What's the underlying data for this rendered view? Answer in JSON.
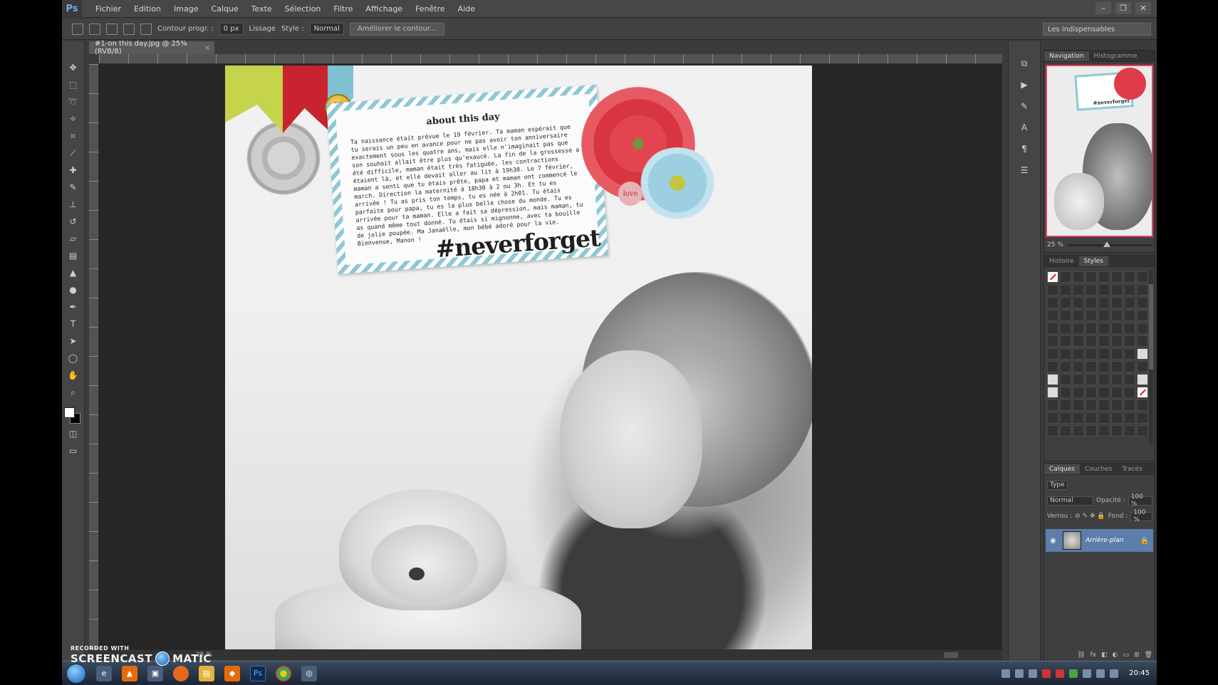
{
  "app": {
    "logo": "Ps",
    "menu": [
      "Fichier",
      "Edition",
      "Image",
      "Calque",
      "Texte",
      "Sélection",
      "Filtre",
      "Affichage",
      "Fenêtre",
      "Aide"
    ],
    "window_controls": [
      "–",
      "❐",
      "✕"
    ]
  },
  "options": {
    "contour_label": "Contour progr. :",
    "contour_value": "0 px",
    "lissage_label": "Lissage",
    "style_label": "Style :",
    "style_value": "Normal",
    "refine_button": "Améliorer le contour...",
    "workspace": "Les indispensables"
  },
  "document": {
    "tab_title": "#1-on this day.jpg @ 25% (RVB/8)",
    "close": "×",
    "zoom_status": "25 %"
  },
  "artwork": {
    "card_title": "about this day",
    "card_text": "Ta naissance était prévue le 19 février. Ta maman espérait que tu serais un peu en avance pour ne pas avoir ton anniversaire exactement sous les quatre ans, mais elle n'imaginait pas que son souhait allait être plus qu'exaucé. La fin de la grossesse a été difficile, maman était très fatiguée, les contractions étaient là, et elle devait aller au lit à 19h30. Le 7 février, maman a senti que tu étais prête, papa et maman ont commencé le march. Direction la maternité à 18h30 à 2 ou 3h. Et tu es arrivée ! Tu as pris ton temps, tu es née à 2h01. Tu étais parfaite pour papa, tu es la plus belle chose du monde. Tu es arrivée pour ta maman. Elle a fait sa dépression, mais maman, tu as quand même tout donné. Tu étais si mignonne, avec ta bouille de jolie poupée. Ma Janaëlle, mon bébé adoré pour la vie. Bienvenue, Manon !",
    "hashtag": "#neverforget",
    "love_label": "love",
    "heart": "♥"
  },
  "panels": {
    "navigator_tabs": [
      "Navigation",
      "Histogramme"
    ],
    "navigator_hashtag": "#neverforget",
    "navigator_zoom": "25 %",
    "styles_tabs": [
      "Histoire",
      "Styles"
    ],
    "layers_tabs": [
      "Calques",
      "Couches",
      "Tracés"
    ],
    "layers_kind": "Type",
    "blend_mode": "Normal",
    "opacity_label": "Opacité :",
    "opacity_value": "100 %",
    "lock_label": "Verrou :",
    "fill_label": "Fond :",
    "fill_value": "100 %",
    "layer_name": "Arrière-plan"
  },
  "taskbar": {
    "clock": "20:45",
    "watermark_line1": "RECORDED WITH",
    "watermark_brand": "SCREENCAST",
    "watermark_brand2": "MATIC"
  },
  "colors": {
    "accent_blue": "#5d7eab",
    "nav_border": "#e64060",
    "card_stripe": "#8ec8d6"
  }
}
